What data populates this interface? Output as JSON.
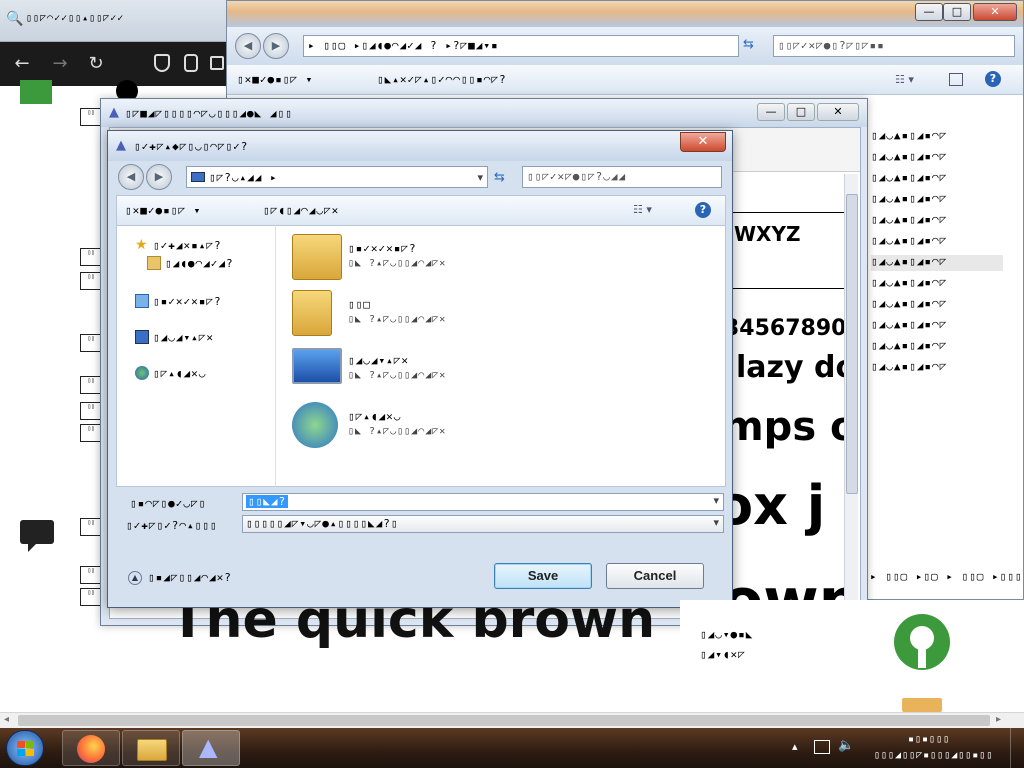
{
  "browser": {
    "tab_title": "▯▯◸◠✓✓▯▯▴▯▯◸✓✓",
    "nav": {
      "back": "←",
      "forward": "→",
      "reload": "↻"
    },
    "left_rows": [
      "▯▯",
      "▯▯",
      "▯▯",
      "▯▯",
      "▯▯",
      "▯▯",
      "▯▯",
      "▯▯",
      "▯▯",
      "▯▯",
      "▯▯"
    ],
    "side_labels": [
      "▯▯",
      "▯▯",
      "▯▯",
      "▯▯",
      "▯▯",
      "▯▯"
    ]
  },
  "explorer": {
    "caption": {
      "minimize": "—",
      "maximize": "□",
      "close": "✕"
    },
    "address": "▸ ▯▯▢ ▸▯◢◖●◠◢✓◢ ? ▸?◸■◢▾▪",
    "search_placeholder": "▯▯◸✓✕◸●▯?◸▯◸▪▪",
    "toolbar_organize": "▯✕■✓●▪▯◸ ▾",
    "toolbar_item2": "▯◣▴✕✓◸▴▯✓◠◠▯▯▪◠◸?",
    "right_list": [
      "▯◢◡▲▪▯◢▪◠◸",
      "▯◢◡▲▪▯◢▪◠◸",
      "▯◢◡▲▪▯◢▪◠◸",
      "▯◢◡▲▪▯◢▪◠◸",
      "▯◢◡▲▪▯◢▪◠◸",
      "▯◢◡▲▪▯◢▪◠◸",
      "▯◢◡▲▪▯◢▪◠◸",
      "▯◢◡▲▪▯◢▪◠◸",
      "▯◢◡▲▪▯◢▪◠◸",
      "▯◢◡▲▪▯◢▪◠◸",
      "▯◢◡▲▪▯◢▪◠◸",
      "▯◢◡▲▪▯◢▪◠◸",
      "▯◢◡▲▪▯◢▪◠◸"
    ],
    "preview_lines": [
      "WXYZ",
      "34567890",
      "lazy do",
      "mps o",
      "ox j",
      "own"
    ],
    "bottom_row": "▸ ▯▯▢ ▸▯▢ ▸ ▯▯▢ ▸▯▯▯",
    "far_right_rows": [
      "▯◢◡▾●▪◣",
      "▯◢▾◖✕◸"
    ]
  },
  "midwin": {
    "title": "▯◸■◢◸▯▯▯▯◠◸◡▯▯▯◢●◣ ◢▯▯",
    "caption": {
      "minimize": "—",
      "maximize": "□",
      "close": "✕"
    },
    "bottom_text": "The quick brown"
  },
  "dialog": {
    "title": "▯✓✚◸▴◆◸▯◡▯◠◸▯✓?",
    "close": "✕",
    "address": "▯◸?◡▴◢◢ ▸",
    "search_placeholder": "▯▯◸✓✕◸●▯◸?◡◢◢",
    "toolbar_organize": "▯✕■✓●▪▯◸ ▾",
    "toolbar_newfolder": "▯◸◖▯◢◠◢◡◸✕",
    "nav_items": [
      {
        "label": "▯✓✚◢✕▪▴◸?"
      },
      {
        "label": "▯◢◖●◠◢✓◢?"
      },
      {
        "label": "▯▪✓✕✓✕▪◸?"
      },
      {
        "label": "▯◢◡◢▾▴◸✕"
      },
      {
        "label": "▯◸▴◖◢✕◡"
      }
    ],
    "items": [
      {
        "name": "▯▪✓✕✓✕▪◸?",
        "sub": "▯◣ ?▴◸◡▯▯◢◠◢◸✕"
      },
      {
        "name": "▯▯□",
        "sub": "▯◣ ?▴◸◡▯▯◢◠◢◸✕"
      },
      {
        "name": "▯◢◡◢▾▴◸✕",
        "sub": "▯◣ ?▴◸◡▯▯◢◠◢◸✕"
      },
      {
        "name": "▯◸▴◖◢✕◡",
        "sub": "▯◣ ?▴◸◡▯▯◢◠◢◸✕"
      }
    ],
    "filename_label": "▯▪◠◸▯●✓◡◸▯",
    "filename_value": "▯▯◣◢?",
    "filetype_label": "▯✓✚◸▯✓?◠▴▯▯▯",
    "filetype_value": "▯▯▯▯▯◢◸▾◡◸●▴▯▯▯▯◣◢?▯",
    "hide_folders": "▯▪◢◸▯▯◢◠◢✕?",
    "save_label": "Save",
    "cancel_label": "Cancel"
  },
  "taskbar": {
    "tray_time": "▪▯▪▯▯▯",
    "tray_date": "▯▯▯◢▯▯◸▪▯▯▯◢▯▯▪▯▯"
  },
  "colors": {
    "accent": "#3399ff",
    "close_red": "#cc4a30",
    "taskbar": "#2e1c12"
  }
}
